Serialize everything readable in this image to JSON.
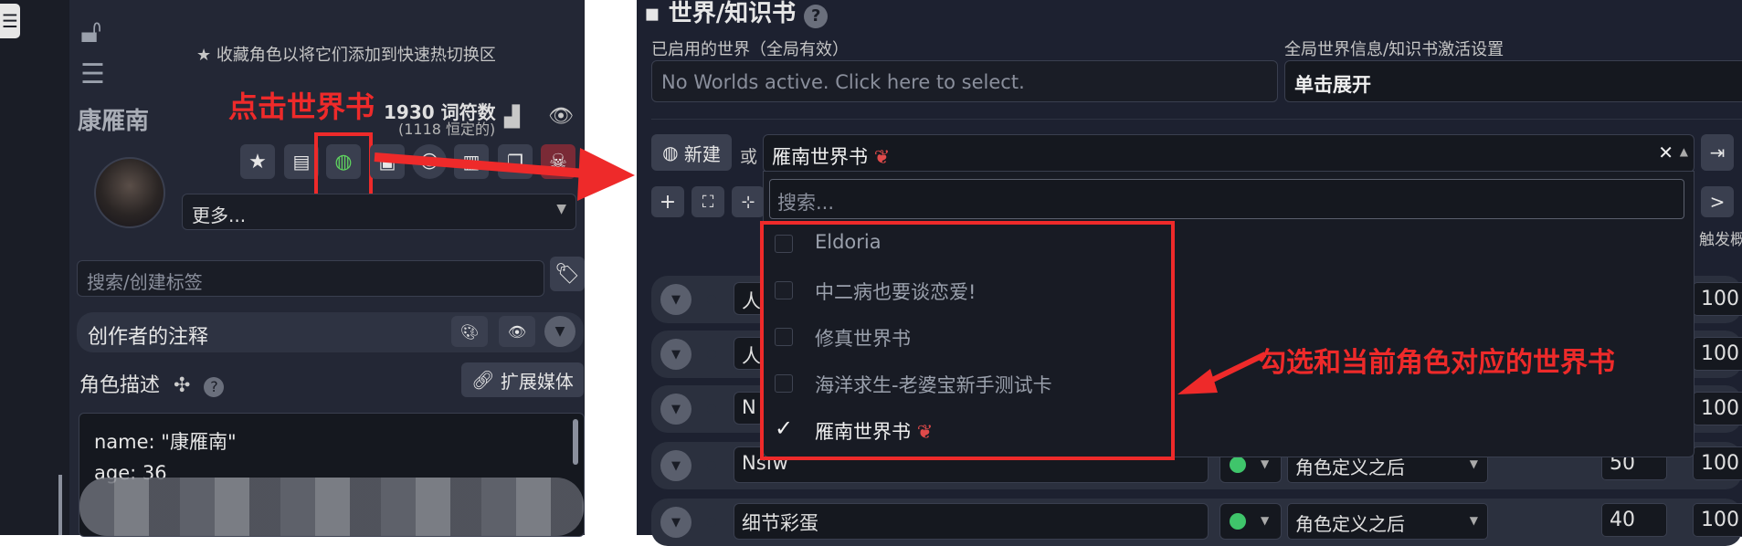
{
  "left": {
    "favorite_hint": "收藏角色以将它们添加到快速热切换区",
    "click_annotation": "点击世界书",
    "char_name": "康雁南",
    "token_count": "1930 词符数",
    "token_fixed": "(1118 恒定的)",
    "more_label": "更多...",
    "tag_placeholder": "搜索/创建标签",
    "creator_notes_label": "创作者的注释",
    "desc_label": "角色描述",
    "expand_media_label": "扩展媒体",
    "desc_lines": [
      "name: \"康雁南\"",
      "age: 36"
    ]
  },
  "right": {
    "title": "世界/知识书",
    "active_worlds_label": "已启用的世界（全局有效）",
    "active_worlds_placeholder": "No Worlds active. Click here to select.",
    "global_settings_label": "全局世界信息/知识书激活设置",
    "global_settings_value": "单击展开",
    "new_label": "新建",
    "or_label": "或",
    "selected_book": "雁南世界书",
    "search_placeholder": "搜索...",
    "trigger_header": "触发概率%",
    "entries": [
      {
        "label": "人",
        "position": "",
        "order": "",
        "prob": "100"
      },
      {
        "label": "人",
        "position": "",
        "order": "",
        "prob": "100"
      },
      {
        "label": "N",
        "position": "",
        "order": "",
        "prob": "100"
      },
      {
        "label": "Nsfw",
        "position": "角色定义之后",
        "order": "50",
        "prob": "100"
      },
      {
        "label": "细节彩蛋",
        "position": "角色定义之后",
        "order": "40",
        "prob": "100"
      }
    ],
    "dropdown_options": [
      {
        "label": "Eldoria",
        "checked": false
      },
      {
        "label": "中二病也要谈恋爱!",
        "checked": false
      },
      {
        "label": "修真世界书",
        "checked": false
      },
      {
        "label": "海洋求生-老婆宝新手测试卡",
        "checked": false
      },
      {
        "label": "雁南世界书",
        "checked": true
      }
    ],
    "select_annotation": "勾选和当前角色对应的世界书"
  },
  "colors": {
    "annotation_red": "#ee2a2a",
    "toggle_on": "#3fc56b"
  }
}
